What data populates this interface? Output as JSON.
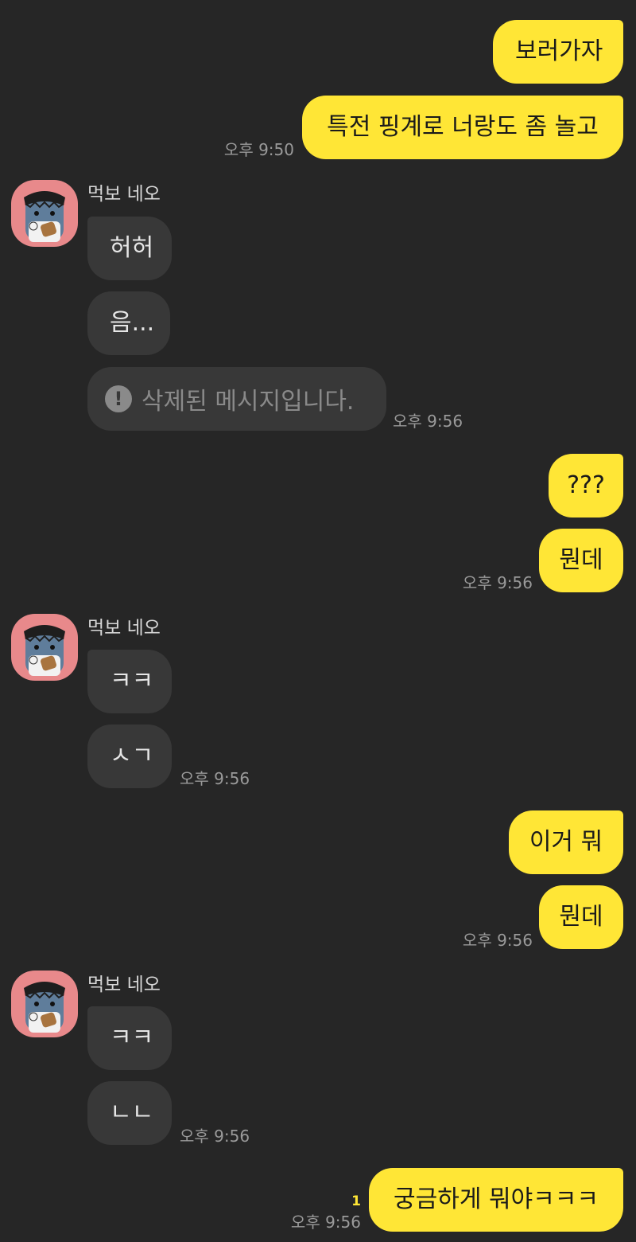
{
  "colors": {
    "background": "#262626",
    "my_bubble": "#FFE636",
    "their_bubble": "#383838",
    "avatar_background": "#E8898B",
    "timestamp": "#9a9a9a",
    "unread": "#FFE636"
  },
  "sender_name": "먹보 네오",
  "messages": {
    "m1": "보러가자",
    "m2": "특전 핑계로 너랑도 좀 놀고",
    "t1": "오후 9:50",
    "r1": "허허",
    "r2": "음...",
    "r3": "삭제된 메시지입니다.",
    "t2": "오후 9:56",
    "m3": "???",
    "m4": "뭔데",
    "t3": "오후 9:56",
    "r4": "ㅋㅋ",
    "r5": "ㅅㄱ",
    "t4": "오후 9:56",
    "m5": "이거 뭐",
    "m6": "뭔데",
    "t5": "오후 9:56",
    "r6": "ㅋㅋ",
    "r7": "ㄴㄴ",
    "t6": "오후 9:56",
    "m7": "궁금하게 뭐야ㅋㅋㅋ",
    "t7": "오후 9:56",
    "unread_count": "1"
  },
  "icons": {
    "deleted": "exclamation-circle-icon",
    "avatar": "bear-character-avatar"
  },
  "deleted_icon_glyph": "!"
}
